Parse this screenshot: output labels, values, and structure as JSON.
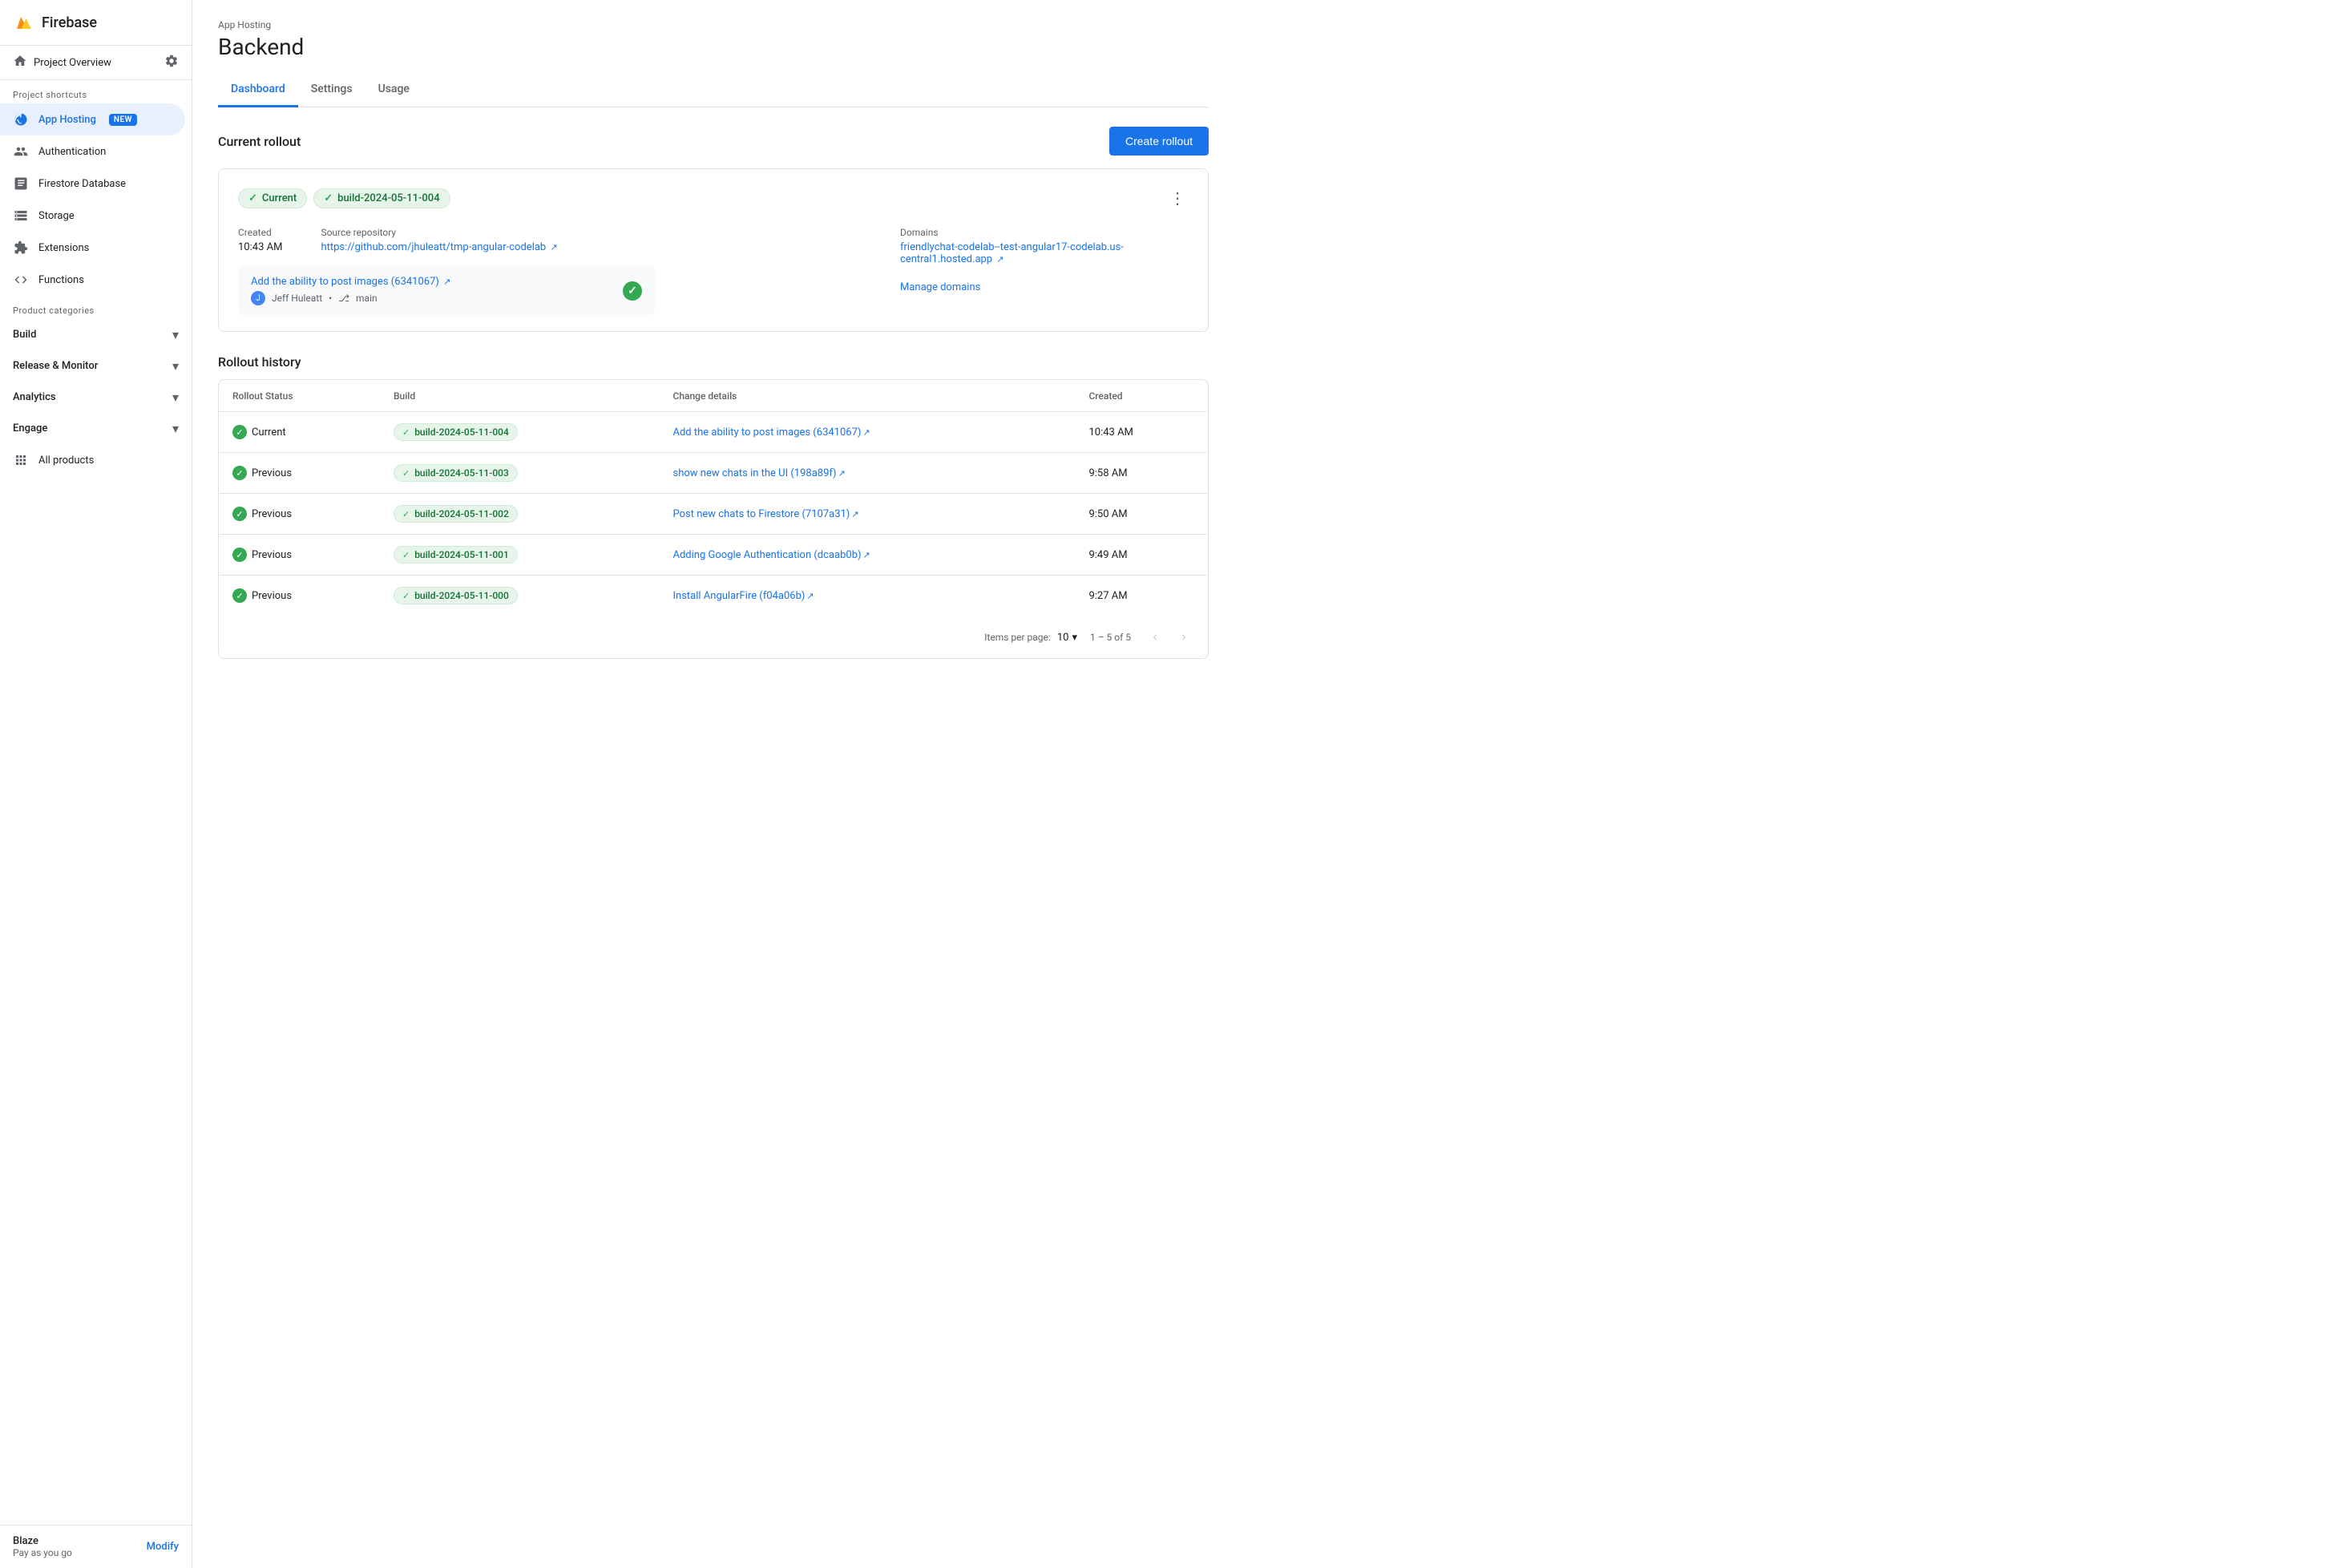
{
  "app": {
    "name": "Firebase"
  },
  "sidebar": {
    "project_overview": "Project Overview",
    "section_shortcuts": "Project shortcuts",
    "section_categories": "Product categories",
    "items": [
      {
        "id": "app-hosting",
        "label": "App Hosting",
        "badge": "NEW",
        "active": true
      },
      {
        "id": "authentication",
        "label": "Authentication"
      },
      {
        "id": "firestore",
        "label": "Firestore Database"
      },
      {
        "id": "storage",
        "label": "Storage"
      },
      {
        "id": "extensions",
        "label": "Extensions"
      },
      {
        "id": "functions",
        "label": "Functions"
      }
    ],
    "categories": [
      {
        "id": "build",
        "label": "Build"
      },
      {
        "id": "release-monitor",
        "label": "Release & Monitor"
      },
      {
        "id": "analytics",
        "label": "Analytics"
      },
      {
        "id": "engage",
        "label": "Engage"
      }
    ],
    "all_products": "All products",
    "blaze_plan": "Blaze",
    "blaze_sub": "Pay as you go",
    "modify_btn": "Modify"
  },
  "header": {
    "breadcrumb": "App Hosting",
    "title": "Backend"
  },
  "tabs": [
    {
      "id": "dashboard",
      "label": "Dashboard",
      "active": true
    },
    {
      "id": "settings",
      "label": "Settings"
    },
    {
      "id": "usage",
      "label": "Usage"
    }
  ],
  "current_rollout": {
    "section_title": "Current rollout",
    "create_btn": "Create rollout",
    "tag_current": "Current",
    "tag_build": "build-2024-05-11-004",
    "created_label": "Created",
    "created_value": "10:43 AM",
    "source_label": "Source repository",
    "source_link": "https://github.com/jhuleatt/tmp-angular-codelab",
    "domains_label": "Domains",
    "domain_link": "friendlychat-codelab--test-angular17-codelab.us-central1.hosted.app",
    "commit_title": "Add the ability to post images (6341067)",
    "commit_author": "Jeff Huleatt",
    "commit_branch": "main",
    "manage_domains": "Manage domains"
  },
  "rollout_history": {
    "section_title": "Rollout history",
    "columns": [
      "Rollout Status",
      "Build",
      "Change details",
      "Created"
    ],
    "rows": [
      {
        "status": "Current",
        "build": "build-2024-05-11-004",
        "change": "Add the ability to post images (6341067)",
        "created": "10:43 AM"
      },
      {
        "status": "Previous",
        "build": "build-2024-05-11-003",
        "change": "show new chats in the UI (198a89f)",
        "created": "9:58 AM"
      },
      {
        "status": "Previous",
        "build": "build-2024-05-11-002",
        "change": "Post new chats to Firestore (7107a31)",
        "created": "9:50 AM"
      },
      {
        "status": "Previous",
        "build": "build-2024-05-11-001",
        "change": "Adding Google Authentication (dcaab0b)",
        "created": "9:49 AM"
      },
      {
        "status": "Previous",
        "build": "build-2024-05-11-000",
        "change": "Install AngularFire (f04a06b)",
        "created": "9:27 AM"
      }
    ],
    "items_per_page_label": "Items per page:",
    "items_per_page_value": "10",
    "pagination_text": "1 – 5 of 5"
  }
}
